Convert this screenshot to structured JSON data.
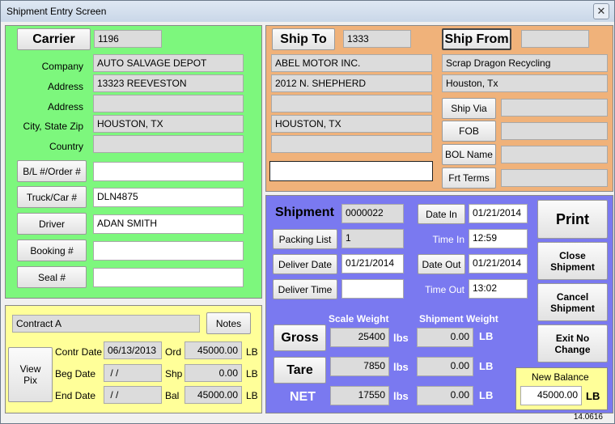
{
  "window": {
    "title": "Shipment Entry Screen",
    "close_glyph": "✕",
    "version": "14.0616"
  },
  "carrier": {
    "button": "Carrier",
    "id": "1196",
    "labels": {
      "company": "Company",
      "address1": "Address",
      "address2": "Address",
      "city": "City, State Zip",
      "country": "Country"
    },
    "company": "AUTO SALVAGE DEPOT",
    "address1": "13323 REEVESTON",
    "address2": "",
    "city": "HOUSTON, TX",
    "country": "",
    "bl_button": "B/L #/Order #",
    "bl_value": "",
    "truck_button": "Truck/Car #",
    "truck_value": "DLN4875",
    "driver_button": "Driver",
    "driver_value": "ADAN SMITH",
    "booking_button": "Booking #",
    "booking_value": "",
    "seal_button": "Seal #",
    "seal_value": ""
  },
  "ship_to": {
    "button": "Ship To",
    "id": "1333",
    "line1": "ABEL MOTOR INC.",
    "line2": "2012 N. SHEPHERD",
    "line3": "",
    "line4": "HOUSTON, TX",
    "line5": "",
    "line6": ""
  },
  "ship_from": {
    "button": "Ship From",
    "id": "",
    "name": "Scrap Dragon Recycling",
    "city": "Houston, Tx",
    "ship_via_button": "Ship Via",
    "ship_via_value": "",
    "fob_button": "FOB",
    "fob_value": "",
    "bol_button": "BOL Name",
    "bol_value": "",
    "frt_button": "Frt Terms",
    "frt_value": ""
  },
  "contract": {
    "name": "Contract A",
    "notes_button": "Notes",
    "view_pix_button": "View\nPix",
    "contr_date_label": "Contr Date",
    "contr_date": "06/13/2013",
    "beg_date_label": "Beg Date",
    "beg_date": " / /",
    "end_date_label": "End Date",
    "end_date": " / /",
    "ord_label": "Ord",
    "ord": "45000.00",
    "ord_unit": "LB",
    "shp_label": "Shp",
    "shp": "0.00",
    "shp_unit": "LB",
    "bal_label": "Bal",
    "bal": "45000.00",
    "bal_unit": "LB"
  },
  "shipment": {
    "title": "Shipment",
    "number": "0000022",
    "packing_button": "Packing List",
    "packing_value": "1",
    "deliver_date_button": "Deliver Date",
    "deliver_date": "01/21/2014",
    "deliver_time_button": "Deliver Time",
    "deliver_time": "",
    "date_in_button": "Date In",
    "date_in": "01/21/2014",
    "time_in_label": "Time In",
    "time_in": "12:59",
    "date_out_button": "Date Out",
    "date_out": "01/21/2014",
    "time_out_label": "Time Out",
    "time_out": "13:02",
    "scale_weight_header": "Scale Weight",
    "shipment_weight_header": "Shipment Weight",
    "gross_button": "Gross",
    "gross_scale": "25400",
    "gross_ship": "0.00",
    "tare_button": "Tare",
    "tare_scale": "7850",
    "tare_ship": "0.00",
    "net_label": "NET",
    "net_scale": "17550",
    "net_ship": "0.00",
    "lbs_unit": "lbs",
    "lb_unit": "LB"
  },
  "actions": {
    "print": "Print",
    "close": "Close\nShipment",
    "cancel": "Cancel\nShipment",
    "exit": "Exit No\nChange",
    "new_balance_label": "New Balance",
    "new_balance": "45000.00",
    "new_balance_unit": "LB"
  },
  "colors": {
    "carrier_panel": "#7df77d",
    "shipto_panel": "#f0b27a",
    "shipment_panel": "#7a79f0",
    "contract_panel": "#ffff99"
  }
}
